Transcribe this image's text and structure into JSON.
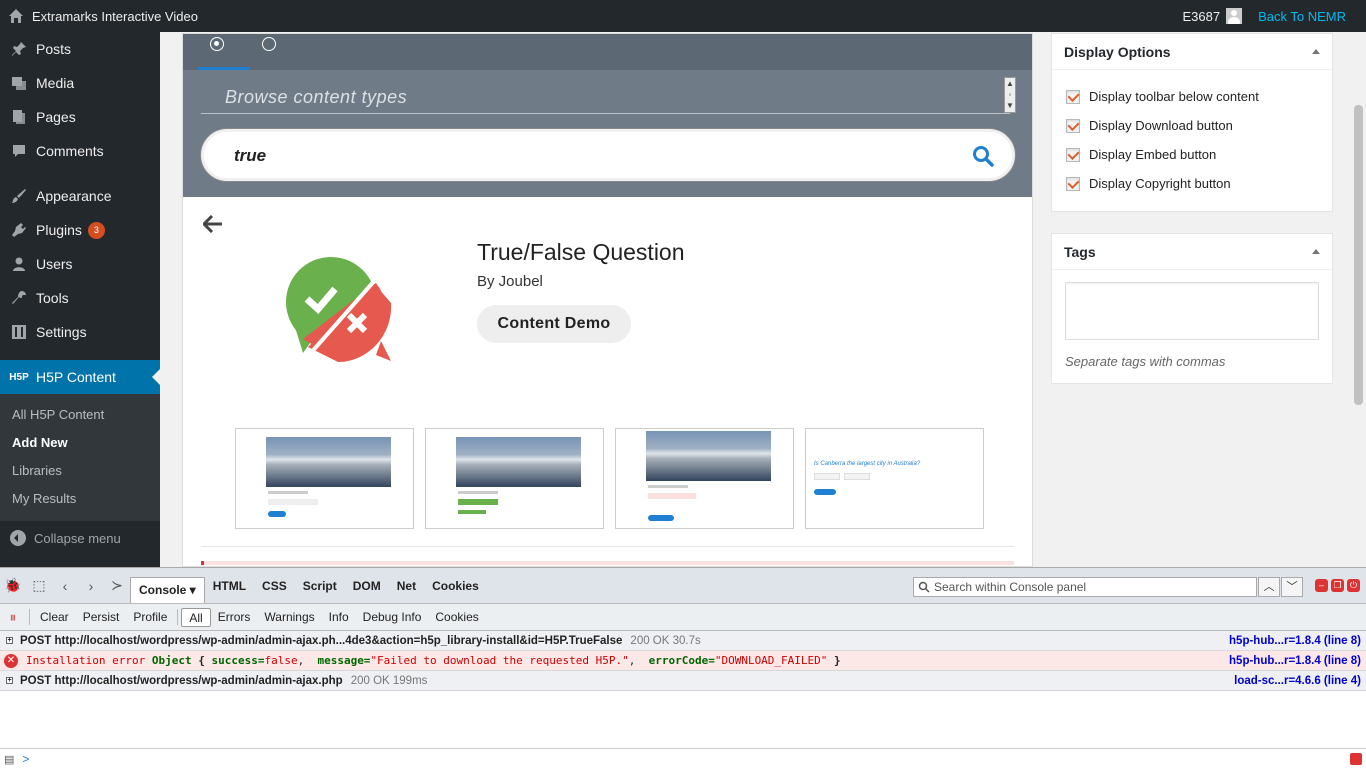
{
  "adminbar": {
    "site_title": "Extramarks Interactive Video",
    "user": "E3687",
    "back_link": "Back To NEMR"
  },
  "sidebar": {
    "items": [
      {
        "label": "Posts",
        "icon": "pin-icon"
      },
      {
        "label": "Media",
        "icon": "media-icon"
      },
      {
        "label": "Pages",
        "icon": "pages-icon"
      },
      {
        "label": "Comments",
        "icon": "comment-icon"
      },
      {
        "label": "Appearance",
        "icon": "brush-icon"
      },
      {
        "label": "Plugins",
        "icon": "plugin-icon",
        "badge": "3"
      },
      {
        "label": "Users",
        "icon": "users-icon"
      },
      {
        "label": "Tools",
        "icon": "wrench-icon"
      },
      {
        "label": "Settings",
        "icon": "settings-icon"
      }
    ],
    "current": {
      "icon_text": "H5P",
      "label": "H5P Content"
    },
    "submenu": [
      "All H5P Content",
      "Add New",
      "Libraries",
      "My Results"
    ],
    "collapse": "Collapse menu"
  },
  "editor": {
    "browse_placeholder": "Browse content types",
    "search_value": "true",
    "content_title": "True/False Question",
    "content_author": "By Joubel",
    "demo_button": "Content Demo",
    "screenshot4_question": "Is Canberra the largest city in Australia?"
  },
  "display_options": {
    "title": "Display Options",
    "options": [
      "Display toolbar below content",
      "Display Download button",
      "Display Embed button",
      "Display Copyright button"
    ]
  },
  "tags": {
    "title": "Tags",
    "hint": "Separate tags with commas"
  },
  "firebug": {
    "tabs": [
      "Console",
      "HTML",
      "CSS",
      "Script",
      "DOM",
      "Net",
      "Cookies"
    ],
    "search_placeholder": "Search within Console panel",
    "actions": [
      "Clear",
      "Persist",
      "Profile"
    ],
    "filters": [
      "All",
      "Errors",
      "Warnings",
      "Info",
      "Debug Info",
      "Cookies"
    ],
    "logs": [
      {
        "method": "POST",
        "url": "http://localhost/wordpress/wp-admin/admin-ajax.ph...4de3&action=h5p_library-install&id=H5P.TrueFalse",
        "status": "200 OK 30.7s",
        "source": "h5p-hub...r=1.8.4 (line 8)"
      },
      {
        "label": "Installation error",
        "obj": "Object",
        "brace_open": "{",
        "k1": "success=",
        "v1": "false",
        "k2": "message=",
        "v2": "\"Failed to download the requested H5P.\"",
        "k3": "errorCode=",
        "v3": "\"DOWNLOAD_FAILED\"",
        "brace_close": "}",
        "source": "h5p-hub...r=1.8.4 (line 8)"
      },
      {
        "method": "POST",
        "url": "http://localhost/wordpress/wp-admin/admin-ajax.php",
        "status": "200 OK 199ms",
        "source": "load-sc...r=4.6.6 (line 4)"
      }
    ],
    "prompt": ">"
  },
  "colors": {
    "wp_dark": "#23282d",
    "wp_blue": "#0073aa",
    "h5p_header": "#5c6874",
    "checkbox_accent": "#e0602c",
    "error_red": "#dc3232"
  }
}
